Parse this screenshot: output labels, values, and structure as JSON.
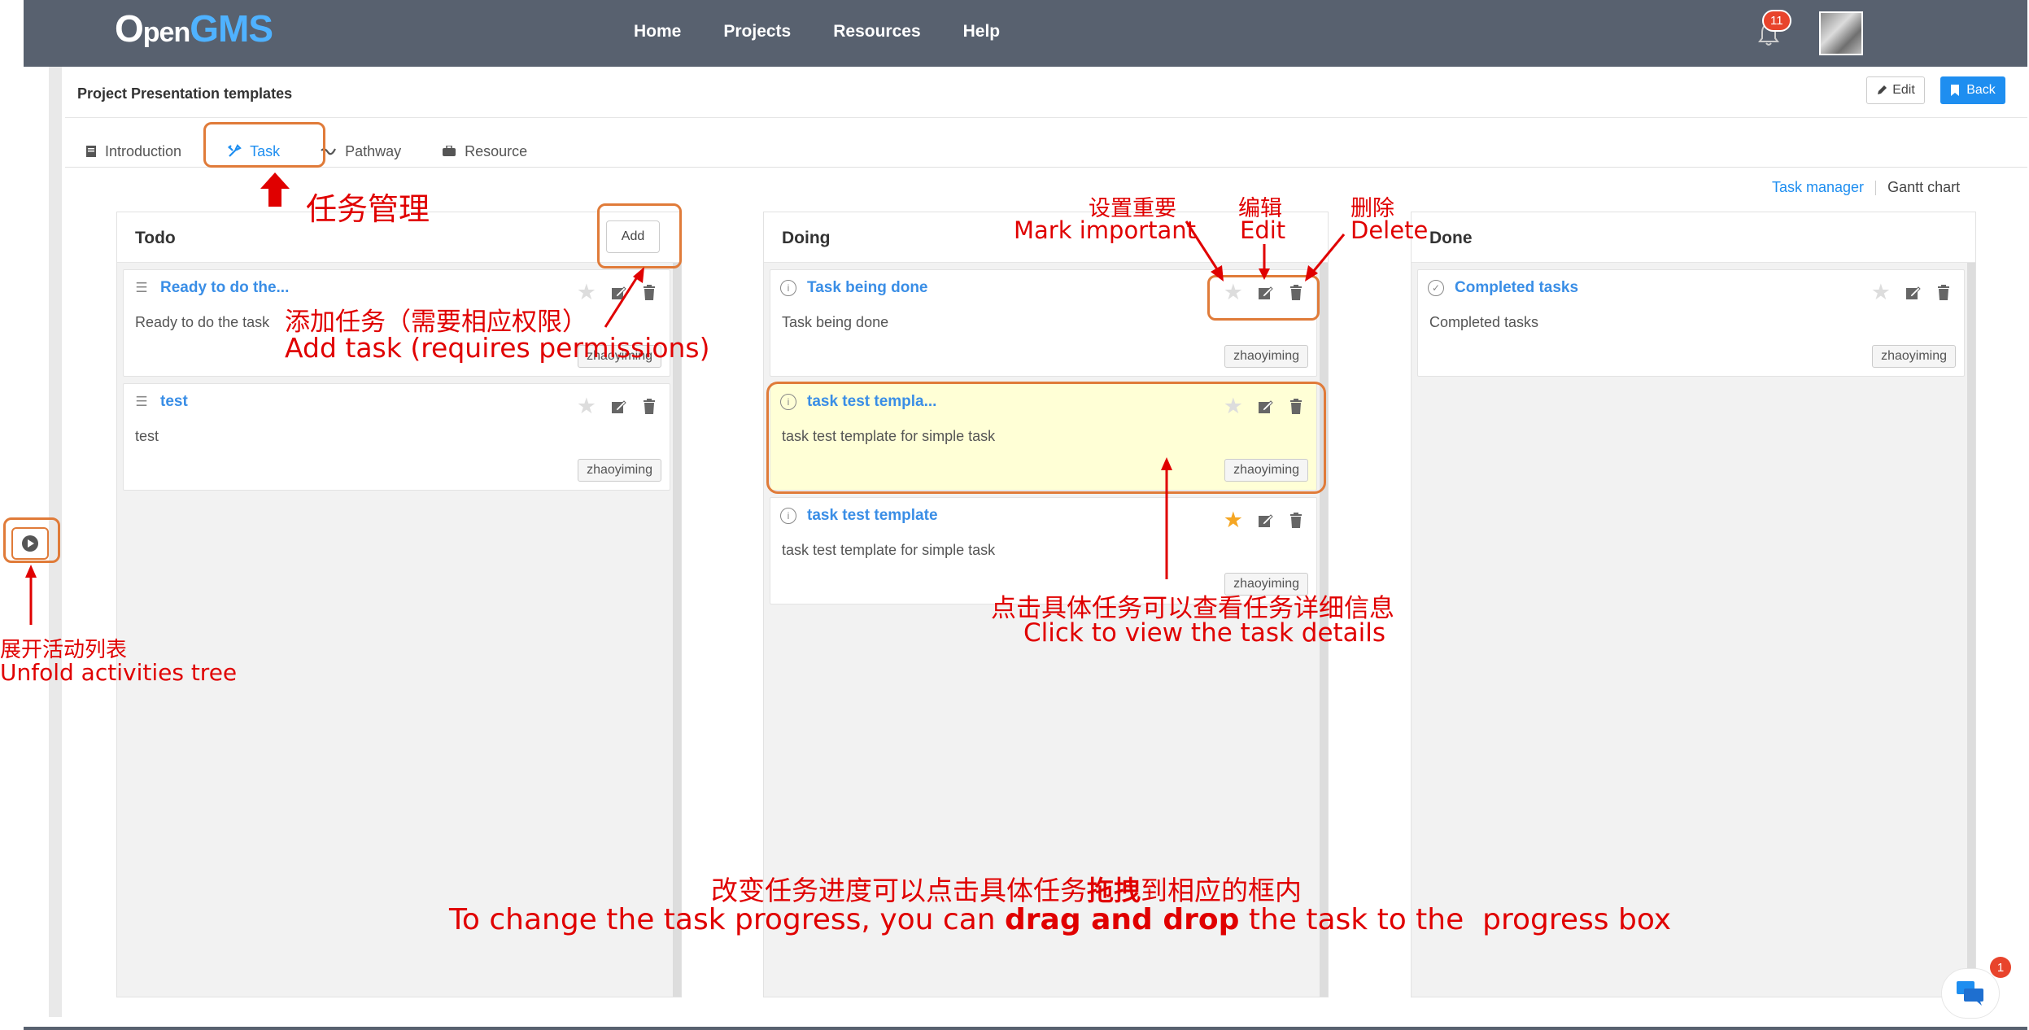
{
  "nav": {
    "logo_o": "O",
    "logo_pen": "pen",
    "logo_gms": "GMS",
    "links": [
      "Home",
      "Projects",
      "Resources",
      "Help"
    ],
    "notification_count": "11"
  },
  "header": {
    "title": "Project Presentation templates",
    "edit_label": "Edit",
    "back_label": "Back"
  },
  "tabs": [
    {
      "label": "Introduction",
      "icon": "book-icon"
    },
    {
      "label": "Task",
      "icon": "tools-icon",
      "active": true
    },
    {
      "label": "Pathway",
      "icon": "pathway-icon"
    },
    {
      "label": "Resource",
      "icon": "briefcase-icon"
    }
  ],
  "view_switch": {
    "task_manager": "Task manager",
    "gantt_chart": "Gantt chart"
  },
  "columns": {
    "todo": {
      "title": "Todo",
      "add_label": "Add",
      "cards": [
        {
          "title": "Ready to do the...",
          "desc": "Ready to do the task",
          "user": "zhaoyiming",
          "starred": false
        },
        {
          "title": "test",
          "desc": "test",
          "user": "zhaoyiming",
          "starred": false
        }
      ]
    },
    "doing": {
      "title": "Doing",
      "cards": [
        {
          "title": "Task being done",
          "desc": "Task being done",
          "user": "zhaoyiming",
          "starred": false
        },
        {
          "title": "task test templa...",
          "desc": "task test template for simple task",
          "user": "zhaoyiming",
          "starred": false
        },
        {
          "title": "task test template",
          "desc": "task test template for simple task",
          "user": "zhaoyiming",
          "starred": true
        }
      ]
    },
    "done": {
      "title": "Done",
      "cards": [
        {
          "title": "Completed tasks",
          "desc": "Completed tasks",
          "user": "zhaoyiming",
          "starred": false
        }
      ]
    }
  },
  "chat_badge": "1",
  "annotations": {
    "task_mgmt": "任务管理",
    "add_cn": "添加任务（需要相应权限）",
    "add_en": "Add task (requires permissions)",
    "important_cn": "设置重要",
    "important_en": "Mark important",
    "edit_cn": "编辑",
    "edit_en": "Edit",
    "delete_cn": "删除",
    "delete_en": "Delete",
    "details_cn": "点击具体任务可以查看任务详细信息",
    "details_en": "Click to view the task details",
    "unfold_cn": "展开活动列表",
    "unfold_en": "Unfold activities tree",
    "drag_cn_1": "改变任务进度可以点击具体任务",
    "drag_cn_bold": "拖拽",
    "drag_cn_2": "到相应的框内",
    "drag_en_1": "To change the task progress, you can ",
    "drag_en_bold": "drag and drop",
    "drag_en_2": " the task to the  progress box"
  },
  "colors": {
    "nav_bg": "#58616f",
    "accent": "#1e8ef0",
    "annotation": "#e00000",
    "highlight_box": "#e07b39"
  }
}
